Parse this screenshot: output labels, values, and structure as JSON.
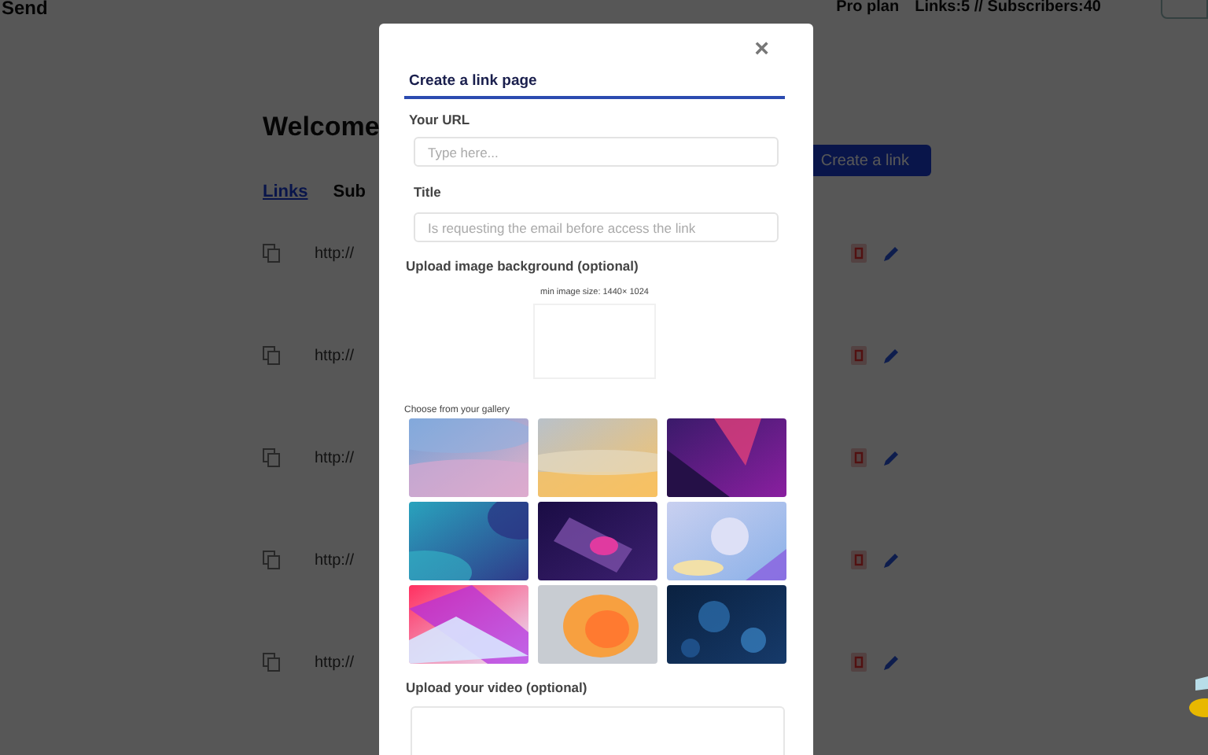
{
  "header": {
    "brand": "Send",
    "plan": "Pro plan",
    "stats": "Links:5 // Subscribers:40"
  },
  "page": {
    "heading": "Welcome",
    "create_button": "Create a link",
    "tabs": [
      {
        "label": "Links",
        "selected": true
      },
      {
        "label": "Sub",
        "selected": false
      }
    ],
    "rows": [
      {
        "url": "http://"
      },
      {
        "url": "http://"
      },
      {
        "url": "http://"
      },
      {
        "url": "http://"
      },
      {
        "url": "http://"
      }
    ]
  },
  "modal": {
    "close": "×",
    "title": "Create a link page",
    "url_field": {
      "label": "Your URL",
      "placeholder": "Type here..."
    },
    "title_field": {
      "label": "Title",
      "placeholder": "Is requesting the email before access the link"
    },
    "image_upload": {
      "label": "Upload image background (optional)",
      "hint": "min image size: 1440× 1024"
    },
    "gallery": {
      "label": "Choose from your gallery"
    },
    "video_upload": {
      "label": "Upload your video (optional)"
    }
  }
}
